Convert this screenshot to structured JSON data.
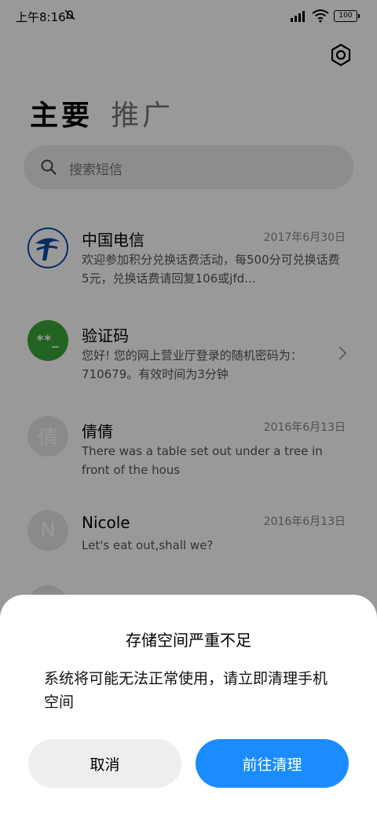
{
  "status_bar": {
    "time": "上午8:16",
    "battery": "100"
  },
  "tabs": [
    {
      "label": "主要"
    },
    {
      "label": "推广"
    }
  ],
  "search": {
    "placeholder": "搜索短信"
  },
  "messages": [
    {
      "sender": "中国电信",
      "date": "2017年6月30日",
      "preview": "欢迎参加积分兑换话费活动，每500分可兑换话费5元，兑换话费请回复106或jfd..."
    },
    {
      "sender": "验证码",
      "avatar_text": "**_",
      "preview": "您好! 您的网上营业厅登录的随机密码为：710679。有效时间为3分钟"
    },
    {
      "sender": "倩倩",
      "avatar_text": "倩",
      "date": "2016年6月13日",
      "preview": "There was a table set out under a tree in front of the hous"
    },
    {
      "sender": "Nicole",
      "avatar_text": "N",
      "date": "2016年6月13日",
      "preview": "Let's eat out,shall we?"
    }
  ],
  "dialog": {
    "title": "存储空间严重不足",
    "message": "系统将可能无法正常使用，请立即清理手机空间",
    "cancel_label": "取消",
    "confirm_label": "前往清理"
  },
  "colors": {
    "accent": "#1a8cff",
    "telecom_blue": "#0a4aa8",
    "code_green": "#3aa53a"
  }
}
